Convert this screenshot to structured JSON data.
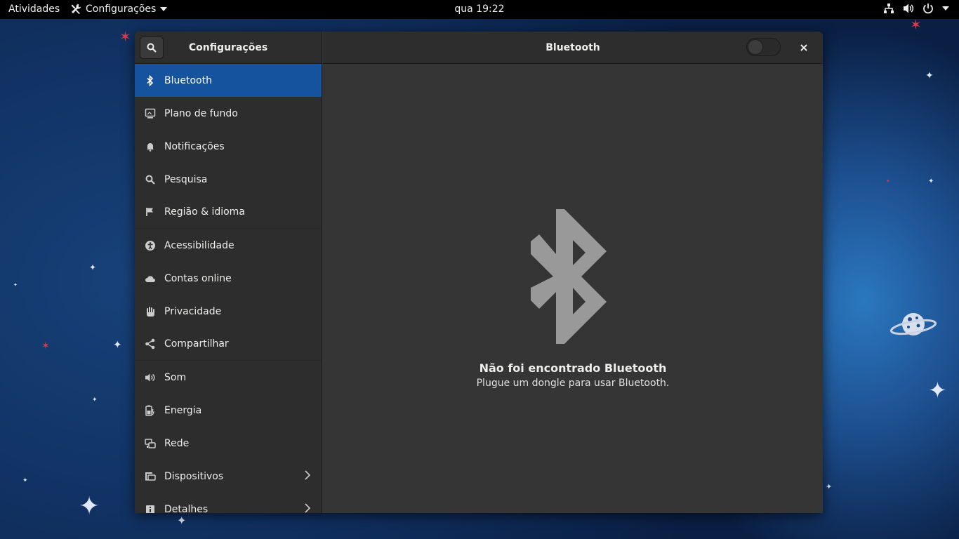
{
  "topbar": {
    "activities": "Atividades",
    "app_menu": "Configurações",
    "clock": "qua 19:22"
  },
  "window": {
    "sidebar_title": "Configurações",
    "panel_title": "Bluetooth",
    "bluetooth_toggle_on": false
  },
  "sidebar": {
    "items": [
      {
        "label": "Bluetooth",
        "icon": "bluetooth-icon",
        "active": true
      },
      {
        "label": "Plano de fundo",
        "icon": "background-icon"
      },
      {
        "label": "Notificações",
        "icon": "bell-icon"
      },
      {
        "label": "Pesquisa",
        "icon": "search-icon"
      },
      {
        "label": "Região & idioma",
        "icon": "flag-icon"
      },
      {
        "label": "Acessibilidade",
        "icon": "accessibility-icon"
      },
      {
        "label": "Contas online",
        "icon": "cloud-icon"
      },
      {
        "label": "Privacidade",
        "icon": "hand-icon"
      },
      {
        "label": "Compartilhar",
        "icon": "share-icon"
      },
      {
        "label": "Som",
        "icon": "speaker-icon"
      },
      {
        "label": "Energia",
        "icon": "battery-icon"
      },
      {
        "label": "Rede",
        "icon": "network-icon"
      },
      {
        "label": "Dispositivos",
        "icon": "devices-icon",
        "has_submenu": true
      },
      {
        "label": "Detalhes",
        "icon": "info-icon",
        "has_submenu": true
      }
    ]
  },
  "main": {
    "empty_title": "Não foi encontrado Bluetooth",
    "empty_subtitle": "Plugue um dongle para usar Bluetooth."
  },
  "colors": {
    "accent": "#15539e",
    "sidebar_bg": "#2d2d2d",
    "main_bg": "#353535"
  }
}
